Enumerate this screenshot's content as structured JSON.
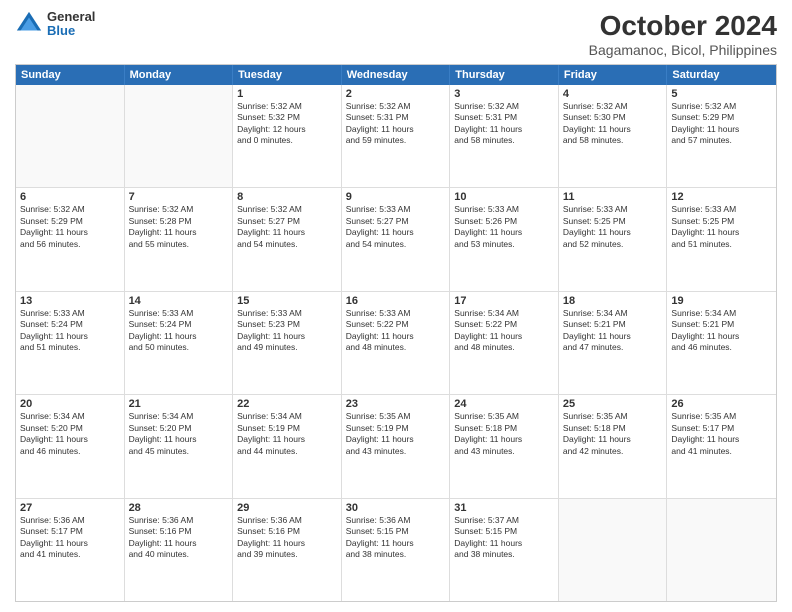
{
  "logo": {
    "general": "General",
    "blue": "Blue"
  },
  "title": "October 2024",
  "subtitle": "Bagamanoc, Bicol, Philippines",
  "days": [
    "Sunday",
    "Monday",
    "Tuesday",
    "Wednesday",
    "Thursday",
    "Friday",
    "Saturday"
  ],
  "rows": [
    [
      {
        "num": "",
        "text": "",
        "empty": true
      },
      {
        "num": "",
        "text": "",
        "empty": true
      },
      {
        "num": "1",
        "text": "Sunrise: 5:32 AM\nSunset: 5:32 PM\nDaylight: 12 hours\nand 0 minutes."
      },
      {
        "num": "2",
        "text": "Sunrise: 5:32 AM\nSunset: 5:31 PM\nDaylight: 11 hours\nand 59 minutes."
      },
      {
        "num": "3",
        "text": "Sunrise: 5:32 AM\nSunset: 5:31 PM\nDaylight: 11 hours\nand 58 minutes."
      },
      {
        "num": "4",
        "text": "Sunrise: 5:32 AM\nSunset: 5:30 PM\nDaylight: 11 hours\nand 58 minutes."
      },
      {
        "num": "5",
        "text": "Sunrise: 5:32 AM\nSunset: 5:29 PM\nDaylight: 11 hours\nand 57 minutes."
      }
    ],
    [
      {
        "num": "6",
        "text": "Sunrise: 5:32 AM\nSunset: 5:29 PM\nDaylight: 11 hours\nand 56 minutes."
      },
      {
        "num": "7",
        "text": "Sunrise: 5:32 AM\nSunset: 5:28 PM\nDaylight: 11 hours\nand 55 minutes."
      },
      {
        "num": "8",
        "text": "Sunrise: 5:32 AM\nSunset: 5:27 PM\nDaylight: 11 hours\nand 54 minutes."
      },
      {
        "num": "9",
        "text": "Sunrise: 5:33 AM\nSunset: 5:27 PM\nDaylight: 11 hours\nand 54 minutes."
      },
      {
        "num": "10",
        "text": "Sunrise: 5:33 AM\nSunset: 5:26 PM\nDaylight: 11 hours\nand 53 minutes."
      },
      {
        "num": "11",
        "text": "Sunrise: 5:33 AM\nSunset: 5:25 PM\nDaylight: 11 hours\nand 52 minutes."
      },
      {
        "num": "12",
        "text": "Sunrise: 5:33 AM\nSunset: 5:25 PM\nDaylight: 11 hours\nand 51 minutes."
      }
    ],
    [
      {
        "num": "13",
        "text": "Sunrise: 5:33 AM\nSunset: 5:24 PM\nDaylight: 11 hours\nand 51 minutes."
      },
      {
        "num": "14",
        "text": "Sunrise: 5:33 AM\nSunset: 5:24 PM\nDaylight: 11 hours\nand 50 minutes."
      },
      {
        "num": "15",
        "text": "Sunrise: 5:33 AM\nSunset: 5:23 PM\nDaylight: 11 hours\nand 49 minutes."
      },
      {
        "num": "16",
        "text": "Sunrise: 5:33 AM\nSunset: 5:22 PM\nDaylight: 11 hours\nand 48 minutes."
      },
      {
        "num": "17",
        "text": "Sunrise: 5:34 AM\nSunset: 5:22 PM\nDaylight: 11 hours\nand 48 minutes."
      },
      {
        "num": "18",
        "text": "Sunrise: 5:34 AM\nSunset: 5:21 PM\nDaylight: 11 hours\nand 47 minutes."
      },
      {
        "num": "19",
        "text": "Sunrise: 5:34 AM\nSunset: 5:21 PM\nDaylight: 11 hours\nand 46 minutes."
      }
    ],
    [
      {
        "num": "20",
        "text": "Sunrise: 5:34 AM\nSunset: 5:20 PM\nDaylight: 11 hours\nand 46 minutes."
      },
      {
        "num": "21",
        "text": "Sunrise: 5:34 AM\nSunset: 5:20 PM\nDaylight: 11 hours\nand 45 minutes."
      },
      {
        "num": "22",
        "text": "Sunrise: 5:34 AM\nSunset: 5:19 PM\nDaylight: 11 hours\nand 44 minutes."
      },
      {
        "num": "23",
        "text": "Sunrise: 5:35 AM\nSunset: 5:19 PM\nDaylight: 11 hours\nand 43 minutes."
      },
      {
        "num": "24",
        "text": "Sunrise: 5:35 AM\nSunset: 5:18 PM\nDaylight: 11 hours\nand 43 minutes."
      },
      {
        "num": "25",
        "text": "Sunrise: 5:35 AM\nSunset: 5:18 PM\nDaylight: 11 hours\nand 42 minutes."
      },
      {
        "num": "26",
        "text": "Sunrise: 5:35 AM\nSunset: 5:17 PM\nDaylight: 11 hours\nand 41 minutes."
      }
    ],
    [
      {
        "num": "27",
        "text": "Sunrise: 5:36 AM\nSunset: 5:17 PM\nDaylight: 11 hours\nand 41 minutes."
      },
      {
        "num": "28",
        "text": "Sunrise: 5:36 AM\nSunset: 5:16 PM\nDaylight: 11 hours\nand 40 minutes."
      },
      {
        "num": "29",
        "text": "Sunrise: 5:36 AM\nSunset: 5:16 PM\nDaylight: 11 hours\nand 39 minutes."
      },
      {
        "num": "30",
        "text": "Sunrise: 5:36 AM\nSunset: 5:15 PM\nDaylight: 11 hours\nand 38 minutes."
      },
      {
        "num": "31",
        "text": "Sunrise: 5:37 AM\nSunset: 5:15 PM\nDaylight: 11 hours\nand 38 minutes."
      },
      {
        "num": "",
        "text": "",
        "empty": true
      },
      {
        "num": "",
        "text": "",
        "empty": true
      }
    ]
  ]
}
